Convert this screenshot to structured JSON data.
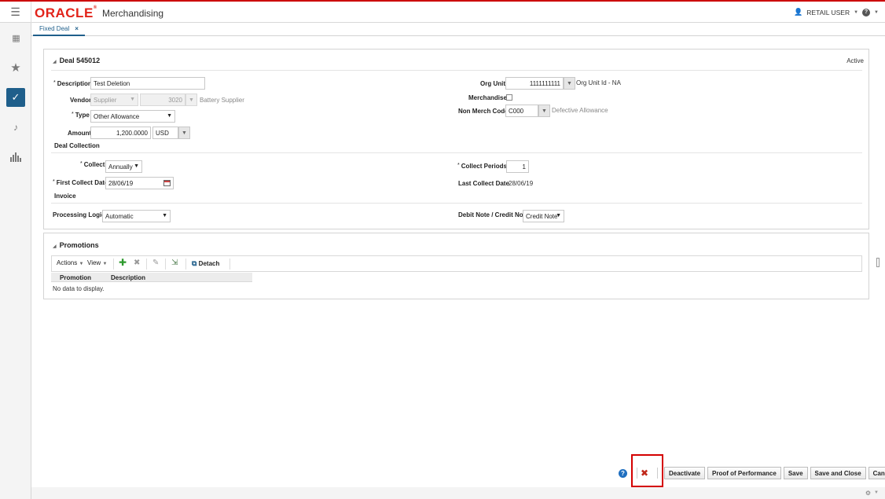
{
  "header": {
    "logo_text": "ORACLE",
    "app_name": "Merchandising",
    "user_name": "RETAIL USER",
    "help_glyph": "?"
  },
  "sidebar": {
    "items": [
      {
        "icon": "grid-icon",
        "glyph": "⋮⋮"
      },
      {
        "icon": "star-icon",
        "glyph": "★"
      },
      {
        "icon": "task-list-icon",
        "glyph": "✓"
      },
      {
        "icon": "notification-bell-icon",
        "glyph": "🔔"
      },
      {
        "icon": "reports-chart-icon",
        "glyph": "▮"
      }
    ]
  },
  "tabs": [
    {
      "label": "Fixed Deal",
      "close": "×"
    }
  ],
  "deal": {
    "title": "Deal 545012",
    "status": "Active",
    "description_label": "Description",
    "description_value": "Test Deletion",
    "vendor_label": "Vendor",
    "vendor_type": "Supplier",
    "vendor_id": "3020",
    "vendor_name": "Battery Supplier",
    "type_label": "Type",
    "type_value": "Other Allowance",
    "amount_label": "Amount",
    "amount_value": "1,200.0000",
    "currency": "USD",
    "org_unit_label": "Org Unit",
    "org_unit_value": "1111111111",
    "org_unit_desc": "Org Unit Id - NA",
    "merchandise_label": "Merchandise",
    "non_merch_label": "Non Merch Code",
    "non_merch_value": "C000",
    "non_merch_desc": "Defective Allowance"
  },
  "collection": {
    "section_label": "Deal Collection",
    "collect_label": "Collect",
    "collect_value": "Annually",
    "collect_periods_label": "Collect Periods",
    "collect_periods_value": "1",
    "first_collect_label": "First Collect Date",
    "first_collect_value": "28/06/19",
    "last_collect_label": "Last Collect Date",
    "last_collect_value": "28/06/19"
  },
  "invoice": {
    "section_label": "Invoice",
    "processing_label": "Processing Logic",
    "processing_value": "Automatic",
    "debit_credit_label": "Debit Note / Credit Note",
    "debit_credit_value": "Credit Note"
  },
  "promotions": {
    "title": "Promotions",
    "actions_label": "Actions",
    "view_label": "View",
    "detach_label": "Detach",
    "columns": [
      "Promotion",
      "Description"
    ],
    "empty_text": "No data to display."
  },
  "buttons": {
    "deactivate": "Deactivate",
    "proof": "Proof of Performance",
    "save": "Save",
    "save_close": "Save and Close",
    "cancel": "Cancel"
  },
  "colors": {
    "brand_red": "#e2231a",
    "accent_blue": "#1f5f8b",
    "highlight_red": "#d40000"
  }
}
